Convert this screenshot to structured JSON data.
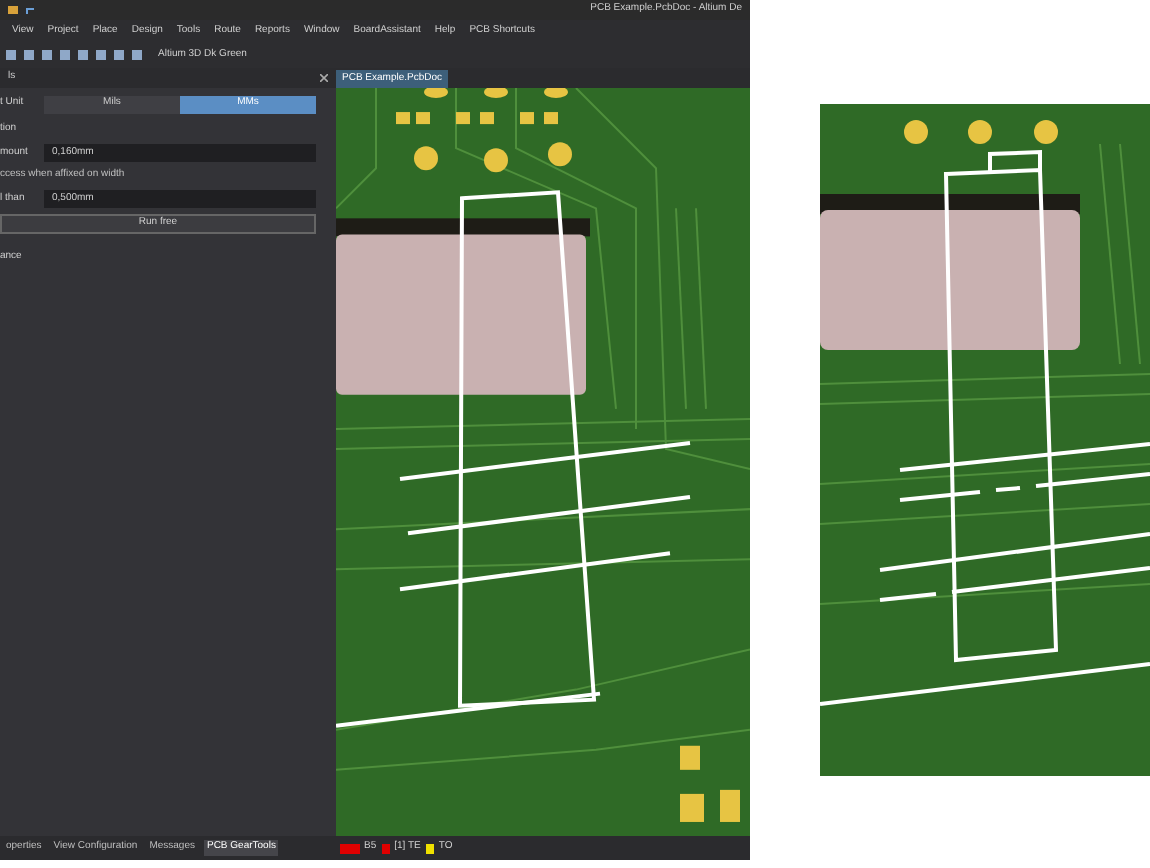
{
  "window": {
    "title": "PCB Example.PcbDoc - Altium De"
  },
  "menu": [
    "View",
    "Project",
    "Place",
    "Design",
    "Tools",
    "Route",
    "Reports",
    "Window",
    "BoardAssistant",
    "Help",
    "PCB Shortcuts"
  ],
  "toolbar": {
    "view_preset": "Altium 3D Dk Green"
  },
  "panel": {
    "title": "ls",
    "unit": {
      "label": "t Unit",
      "options": [
        {
          "label": "Mils",
          "selected": false
        },
        {
          "label": "MMs",
          "selected": true
        }
      ]
    },
    "section": "tion",
    "fields": [
      {
        "label": "mount",
        "value": "0,160mm"
      },
      {
        "note": "ccess when affixed on width"
      },
      {
        "label": "l than",
        "value": "0,500mm"
      }
    ],
    "button": "Run free",
    "section_2": "ance"
  },
  "document_tab": {
    "label": "PCB Example.PcbDoc"
  },
  "bottom_tabs": [
    {
      "label": "operties",
      "selected": false
    },
    {
      "label": "View Configuration",
      "selected": false
    },
    {
      "label": "Messages",
      "selected": false
    },
    {
      "label": "PCB GearTools",
      "selected": true
    }
  ],
  "layers": [
    {
      "label": "B5",
      "color": "#e00000"
    },
    {
      "label": "[1] TE",
      "color": "#e00000"
    },
    {
      "label": "TO",
      "color": "#f0e000"
    }
  ]
}
